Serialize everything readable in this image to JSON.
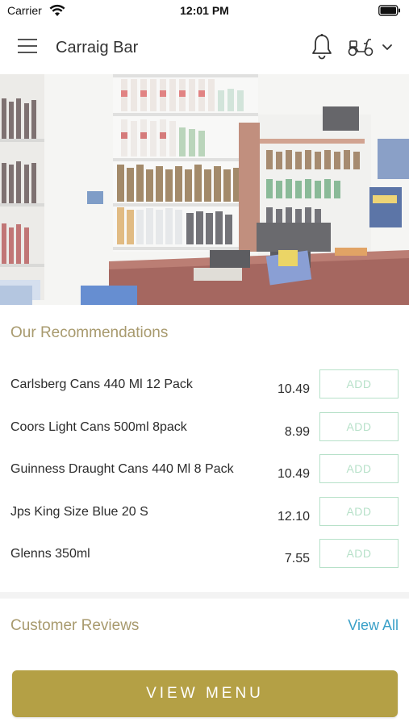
{
  "status_bar": {
    "carrier": "Carrier",
    "time": "12:01 PM"
  },
  "header": {
    "title": "Carraig Bar",
    "icons": [
      "menu-icon",
      "bell-icon",
      "scooter-icon",
      "chevron-down-icon"
    ]
  },
  "recommendations": {
    "title": "Our Recommendations",
    "add_label": "ADD",
    "items": [
      {
        "name": "Carlsberg Cans 440 Ml 12 Pack",
        "price": "10.49"
      },
      {
        "name": "Coors Light Cans 500ml 8pack",
        "price": "8.99"
      },
      {
        "name": "Guinness Draught Cans 440 Ml 8 Pack",
        "price": "10.49"
      },
      {
        "name": "Jps King Size Blue 20 S",
        "price": "12.10"
      },
      {
        "name": "Glenns 350ml",
        "price": "7.55"
      }
    ]
  },
  "reviews": {
    "title": "Customer Reviews",
    "view_all": "View All"
  },
  "footer": {
    "view_menu": "VIEW MENU"
  },
  "colors": {
    "accent_gold": "#b4a045",
    "section_title": "#a89a6e",
    "add_border": "#b7e1c9",
    "link_blue": "#3aa0c8"
  }
}
